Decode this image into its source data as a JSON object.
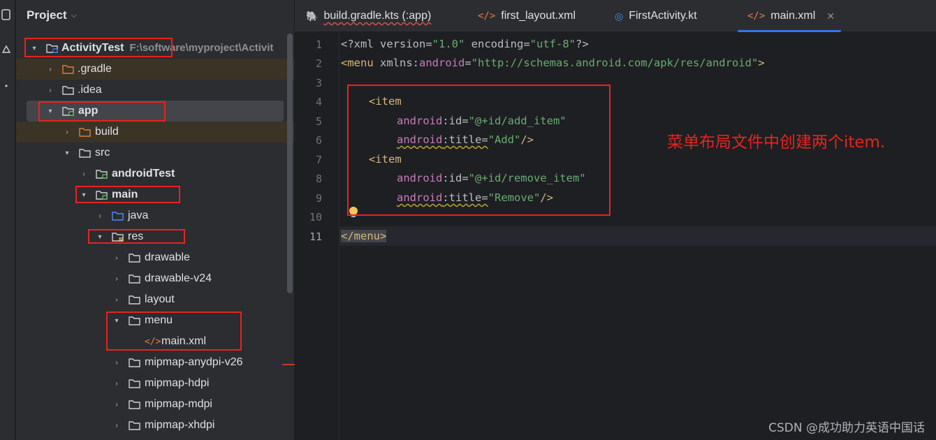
{
  "panel": {
    "title": "Project"
  },
  "tree": {
    "root": {
      "label": "ActivityTest",
      "path": "F:\\software\\myproject\\Activit"
    },
    "gradle": ".gradle",
    "idea": ".idea",
    "app": "app",
    "build": "build",
    "src": "src",
    "androidTest": "androidTest",
    "main": "main",
    "java": "java",
    "res": "res",
    "drawable": "drawable",
    "drawable_v24": "drawable-v24",
    "layout": "layout",
    "menu": "menu",
    "main_xml": "main.xml",
    "mipmap_anydpi": "mipmap-anydpi-v26",
    "mipmap_hdpi": "mipmap-hdpi",
    "mipmap_mdpi": "mipmap-mdpi",
    "mipmap_xhdpi": "mipmap-xhdpi"
  },
  "tabs": [
    {
      "label": "build.gradle.kts (:app)",
      "icon": "gradle-icon"
    },
    {
      "label": "first_layout.xml",
      "icon": "xml-file-icon"
    },
    {
      "label": "FirstActivity.kt",
      "icon": "kotlin-class-icon"
    },
    {
      "label": "main.xml",
      "icon": "xml-file-icon",
      "active": true
    }
  ],
  "editor": {
    "line_numbers": [
      "1",
      "2",
      "3",
      "4",
      "5",
      "6",
      "7",
      "8",
      "9",
      "10",
      "11"
    ],
    "current_line": "11",
    "code": {
      "l1_a": "<?xml version=",
      "l1_b": "\"1.0\"",
      "l1_c": " encoding=",
      "l1_d": "\"utf-8\"",
      "l1_e": "?>",
      "l2_a": "<menu",
      "l2_b": " xmlns:",
      "l2_c": "android",
      "l2_d": "=",
      "l2_e": "\"http://schemas.android.com/apk/res/android\"",
      "l2_f": ">",
      "item_open": "<item",
      "android": "android",
      "id_attr": ":id=",
      "title_attr": ":title=",
      "id_add": "\"@+id/add_item\"",
      "title_add": "\"Add\"",
      "id_remove": "\"@+id/remove_item\"",
      "title_remove": "\"Remove\"",
      "self_close": "/>",
      "menu_close": "</menu>"
    }
  },
  "annotation": "菜单布局文件中创建两个item.",
  "watermark": "CSDN @成功助力英语中国话",
  "colors": {
    "highlight_box": "#e8231e",
    "xml_tag": "#d5b778",
    "xml_namespace": "#c77dbb",
    "xml_value": "#6aab73",
    "active_tab_underline": "#3574f0"
  }
}
